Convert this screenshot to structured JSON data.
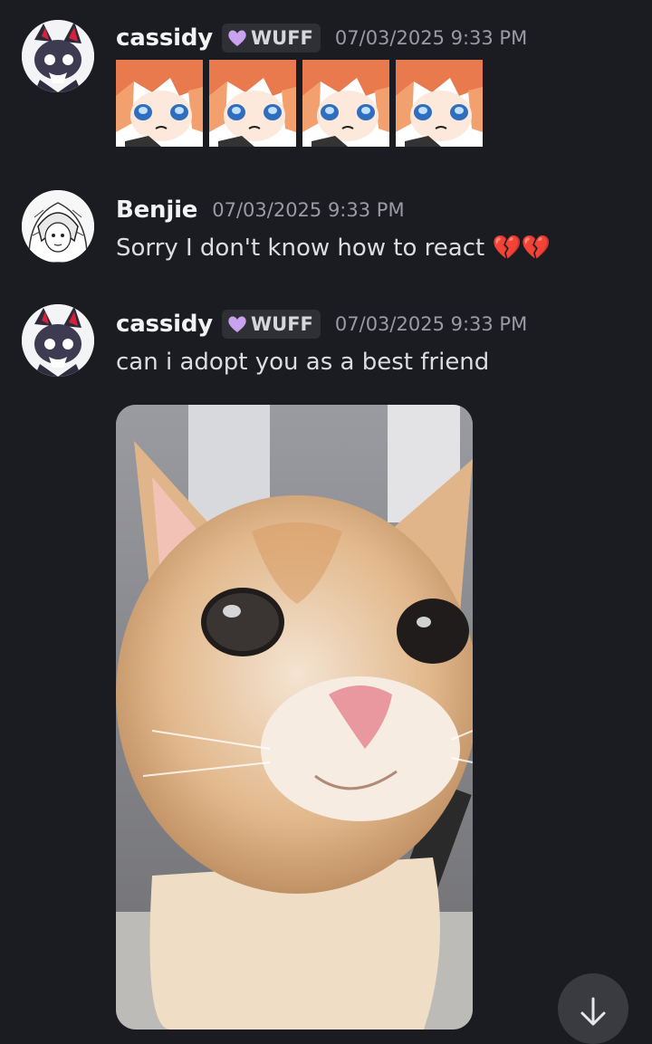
{
  "messages": [
    {
      "username": "cassidy",
      "tag": "WUFF",
      "timestamp": "07/03/2025 9:33 PM",
      "emote_icons": [
        "crying-anime-girl-emote",
        "crying-anime-girl-emote",
        "crying-anime-girl-emote",
        "crying-anime-girl-emote"
      ]
    },
    {
      "username": "Benjie",
      "timestamp": "07/03/2025 9:33 PM",
      "text": "Sorry I don't know how to react 💔💔"
    },
    {
      "username": "cassidy",
      "tag": "WUFF",
      "timestamp": "07/03/2025 9:33 PM",
      "text": "can i adopt you as a best friend",
      "attachment_icon": "kitten-photo"
    }
  ],
  "scroll_button_icon": "arrow-down-icon",
  "colors": {
    "background": "#1b1c21",
    "tag_background": "#2f3036",
    "tag_heart": "#c9a2f0",
    "broken_heart": "#e0303c"
  }
}
